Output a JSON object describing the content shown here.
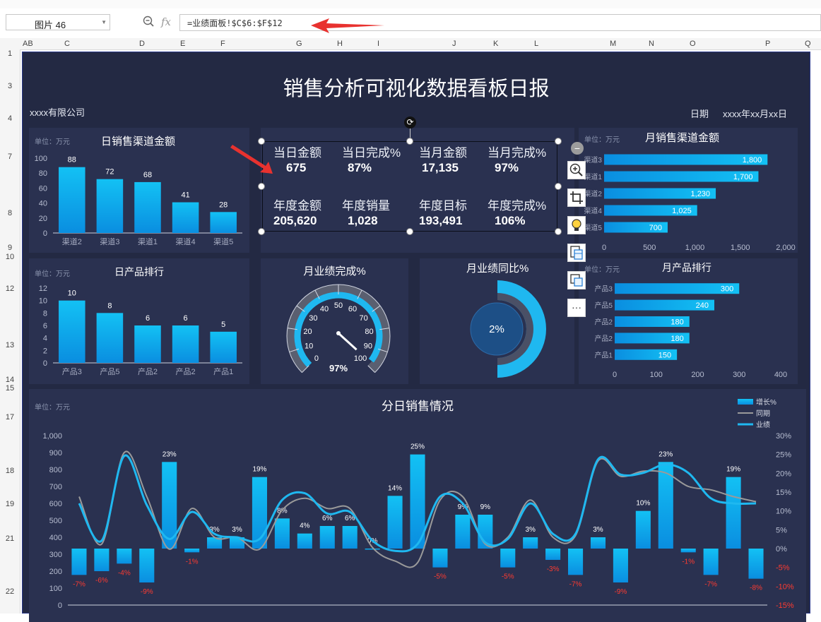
{
  "namebox": {
    "value": "图片 46"
  },
  "formula": {
    "fx": "fx",
    "value": "=业绩面板!$C$6:$F$12"
  },
  "columns": [
    {
      "label": "AB"
    },
    {
      "label": "C"
    },
    {
      "label": "D"
    },
    {
      "label": "E"
    },
    {
      "label": "F"
    },
    {
      "label": "G"
    },
    {
      "label": "H"
    },
    {
      "label": "I"
    },
    {
      "label": "J"
    },
    {
      "label": "K"
    },
    {
      "label": "L"
    },
    {
      "label": "M"
    },
    {
      "label": "N"
    },
    {
      "label": "O"
    },
    {
      "label": "P"
    },
    {
      "label": "Q"
    }
  ],
  "rows": [
    {
      "label": "1"
    },
    {
      "label": "3"
    },
    {
      "label": "4"
    },
    {
      "label": "7"
    },
    {
      "label": "8"
    },
    {
      "label": "9"
    },
    {
      "label": "10"
    },
    {
      "label": "12"
    },
    {
      "label": "13"
    },
    {
      "label": "14"
    },
    {
      "label": "15"
    },
    {
      "label": "17"
    },
    {
      "label": "18"
    },
    {
      "label": "19"
    },
    {
      "label": "21"
    },
    {
      "label": "22"
    }
  ],
  "dashboard": {
    "title": "销售分析可视化数据看板日报",
    "company": "xxxx有限公司",
    "date_label": "日期",
    "date_value": "xxxx年xx月xx日",
    "unit": "单位：万元"
  },
  "kpis": [
    {
      "label": "当日金额",
      "value": "675"
    },
    {
      "label": "当日完成%",
      "value": "87%"
    },
    {
      "label": "当月金额",
      "value": "17,135"
    },
    {
      "label": "当月完成%",
      "value": "97%"
    },
    {
      "label": "年度金额",
      "value": "205,620"
    },
    {
      "label": "年度销量",
      "value": "1,028"
    },
    {
      "label": "年度目标",
      "value": "193,491"
    },
    {
      "label": "年度完成%",
      "value": "106%"
    }
  ],
  "colors": {
    "bar_top": "#13c1f4",
    "bar_bottom": "#0a8ee0",
    "line_business": "#1fb8f0",
    "line_prior": "#9a9a9a",
    "negative": "#ff3b30",
    "panel": "#2a3150",
    "background": "#232943"
  },
  "chart_data": [
    {
      "id": "daily-channel",
      "type": "bar",
      "title": "日销售渠道金额",
      "categories": [
        "渠道2",
        "渠道3",
        "渠道1",
        "渠道4",
        "渠道5"
      ],
      "values": [
        88,
        72,
        68,
        41,
        28
      ],
      "ylim": [
        0,
        100
      ],
      "yticks": [
        0,
        20,
        40,
        60,
        80,
        100
      ]
    },
    {
      "id": "daily-product",
      "type": "bar",
      "title": "日产品排行",
      "categories": [
        "产品3",
        "产品5",
        "产品2",
        "产品2",
        "产品1"
      ],
      "values": [
        10,
        8,
        6,
        6,
        5
      ],
      "ylim": [
        0,
        12
      ],
      "yticks": [
        0,
        2,
        4,
        6,
        8,
        10,
        12
      ]
    },
    {
      "id": "monthly-channel",
      "type": "bar",
      "orientation": "horizontal",
      "title": "月销售渠道金额",
      "categories": [
        "渠道3",
        "渠道1",
        "渠道2",
        "渠道4",
        "渠道5"
      ],
      "values": [
        1800,
        1700,
        1230,
        1025,
        700
      ],
      "value_labels": [
        "1,800",
        "1,700",
        "1,230",
        "1,025",
        "700"
      ],
      "xlim": [
        0,
        2000
      ],
      "xticks": [
        "0",
        "500",
        "1,000",
        "1,500",
        "2,000"
      ]
    },
    {
      "id": "monthly-product",
      "type": "bar",
      "orientation": "horizontal",
      "title": "月产品排行",
      "categories": [
        "产品3",
        "产品5",
        "产品2",
        "产品2",
        "产品1"
      ],
      "values": [
        300,
        240,
        180,
        180,
        150
      ],
      "xlim": [
        0,
        400
      ],
      "xticks": [
        "0",
        "100",
        "200",
        "300",
        "400"
      ]
    },
    {
      "id": "monthly-completion",
      "type": "gauge",
      "title": "月业绩完成%",
      "value": 97,
      "ticks": [
        "0",
        "10",
        "20",
        "30",
        "40",
        "50",
        "60",
        "70",
        "80",
        "90",
        "100"
      ],
      "value_label": "97%"
    },
    {
      "id": "monthly-yoy",
      "type": "pie",
      "title": "月业绩同比%",
      "value": 2,
      "value_label": "2%"
    },
    {
      "id": "daily-trend",
      "type": "bar",
      "title": "分日销售情况",
      "legend": [
        "增长%",
        "同期",
        "业绩"
      ],
      "legend_position": "top-right",
      "left_axis": [
        "0",
        "100",
        "200",
        "300",
        "400",
        "500",
        "600",
        "700",
        "800",
        "900",
        "1,000"
      ],
      "right_axis": [
        "-15%",
        "-10%",
        "-5%",
        "0%",
        "5%",
        "10%",
        "15%",
        "20%",
        "25%",
        "30%"
      ],
      "growth_pct": [
        -7,
        -6,
        -4,
        -9,
        23,
        -1,
        3,
        3,
        19,
        8,
        4,
        6,
        6,
        0,
        14,
        25,
        -5,
        9,
        9,
        -5,
        3,
        -3,
        -7,
        3,
        -9,
        10,
        23,
        -1,
        -7,
        19,
        -8
      ],
      "growth_labels": [
        "-7%",
        "-6%",
        "-4%",
        "-9%",
        "23%",
        "-1%",
        "3%",
        "3%",
        "19%",
        "8%",
        "4%",
        "6%",
        "6%",
        "0%",
        "14%",
        "25%",
        "-5%",
        "9%",
        "9%",
        "-5%",
        "3%",
        "-3%",
        "-7%",
        "3%",
        "-9%",
        "10%",
        "23%",
        "-1%",
        "-7%",
        "19%",
        "-8%"
      ],
      "business": [
        600,
        380,
        880,
        590,
        390,
        550,
        420,
        400,
        390,
        620,
        660,
        540,
        550,
        380,
        320,
        360,
        640,
        600,
        370,
        390,
        600,
        420,
        420,
        860,
        770,
        780,
        830,
        780,
        630,
        600,
        600
      ],
      "prior": [
        640,
        360,
        900,
        640,
        330,
        570,
        400,
        400,
        330,
        560,
        630,
        570,
        570,
        340,
        260,
        250,
        620,
        640,
        360,
        400,
        620,
        400,
        410,
        850,
        760,
        790,
        780,
        700,
        680,
        640,
        610
      ]
    }
  ]
}
